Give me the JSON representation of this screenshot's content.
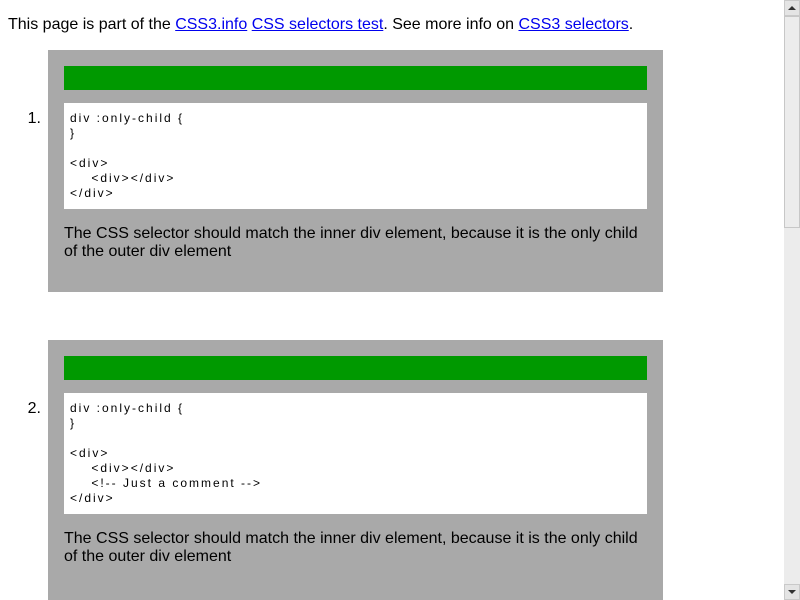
{
  "intro": {
    "prefix": "This page is part of the ",
    "link1": "CSS3.info",
    "space": " ",
    "link2": "CSS selectors test",
    "middle": ". See more info on ",
    "link3": "CSS3 selectors",
    "suffix": "."
  },
  "tests": [
    {
      "number": "1.",
      "code": [
        "div :only-child {",
        "}",
        "",
        "<div>",
        "    <div></div>",
        "</div>"
      ],
      "description": "The CSS selector should match the inner div element, because it is the only child of the outer div element"
    },
    {
      "number": "2.",
      "code": [
        "div :only-child {",
        "}",
        "",
        "<div>",
        "    <div></div>",
        "    <!-- Just a comment -->",
        "</div>"
      ],
      "description": "The CSS selector should match the inner div element, because it is the only child of the outer div element"
    }
  ],
  "colors": {
    "pass_bar": "#009900",
    "panel": "#a9a9a9",
    "link": "#0000ee"
  },
  "scrollbar": {
    "up": "arrow-up-icon",
    "down": "arrow-down-icon"
  }
}
